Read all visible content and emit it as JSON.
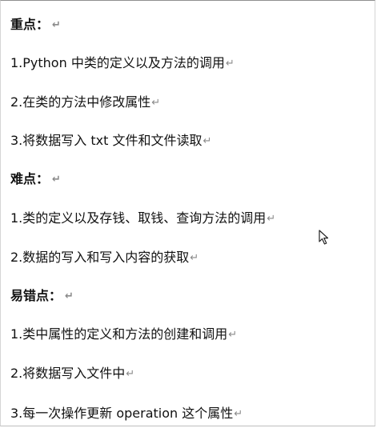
{
  "document": {
    "lines": [
      {
        "text": "重点：",
        "heading": true
      },
      {
        "text": "1.Python 中类的定义以及方法的调用",
        "heading": false
      },
      {
        "text": "2.在类的方法中修改属性",
        "heading": false
      },
      {
        "text": "3.将数据写入 txt 文件和文件读取",
        "heading": false
      },
      {
        "text": "难点：",
        "heading": true
      },
      {
        "text": "1.类的定义以及存钱、取钱、查询方法的调用",
        "heading": false
      },
      {
        "text": "2.数据的写入和写入内容的获取",
        "heading": false
      },
      {
        "text": "易错点：",
        "heading": true
      },
      {
        "text": "1.类中属性的定义和方法的创建和调用",
        "heading": false
      },
      {
        "text": "2.将数据写入文件中",
        "heading": false
      },
      {
        "text": "3.每一次操作更新 operation 这个属性",
        "heading": false
      }
    ],
    "paragraph_mark": "↵"
  },
  "cursor": {
    "icon": "mouse-pointer-icon"
  }
}
